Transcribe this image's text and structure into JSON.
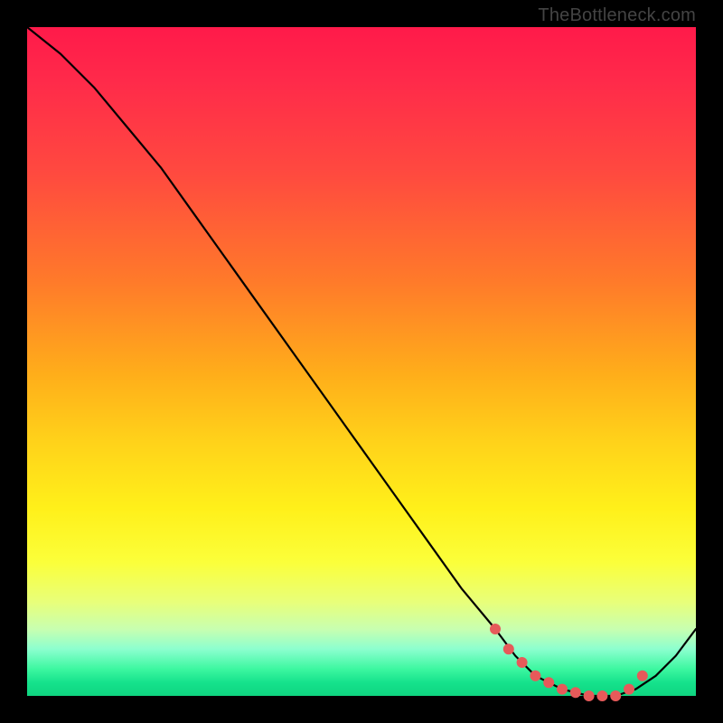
{
  "attribution": "TheBottleneck.com",
  "colors": {
    "dot": "#e65a5a",
    "curve": "#000000",
    "frame": "#000000"
  },
  "chart_data": {
    "type": "line",
    "title": "",
    "xlabel": "",
    "ylabel": "",
    "xlim": [
      0,
      100
    ],
    "ylim": [
      0,
      100
    ],
    "series": [
      {
        "name": "bottleneck-curve",
        "x": [
          0,
          5,
          10,
          15,
          20,
          25,
          30,
          35,
          40,
          45,
          50,
          55,
          60,
          65,
          70,
          73,
          76,
          80,
          84,
          88,
          91,
          94,
          97,
          100
        ],
        "y": [
          100,
          96,
          91,
          85,
          79,
          72,
          65,
          58,
          51,
          44,
          37,
          30,
          23,
          16,
          10,
          6,
          3,
          1,
          0,
          0,
          1,
          3,
          6,
          10
        ]
      }
    ],
    "markers": {
      "name": "optimal-range-dots",
      "x": [
        70,
        72,
        74,
        76,
        78,
        80,
        82,
        84,
        86,
        88,
        90,
        92
      ],
      "y": [
        10,
        7,
        5,
        3,
        2,
        1,
        0.5,
        0,
        0,
        0,
        1,
        3
      ]
    },
    "annotations": []
  }
}
